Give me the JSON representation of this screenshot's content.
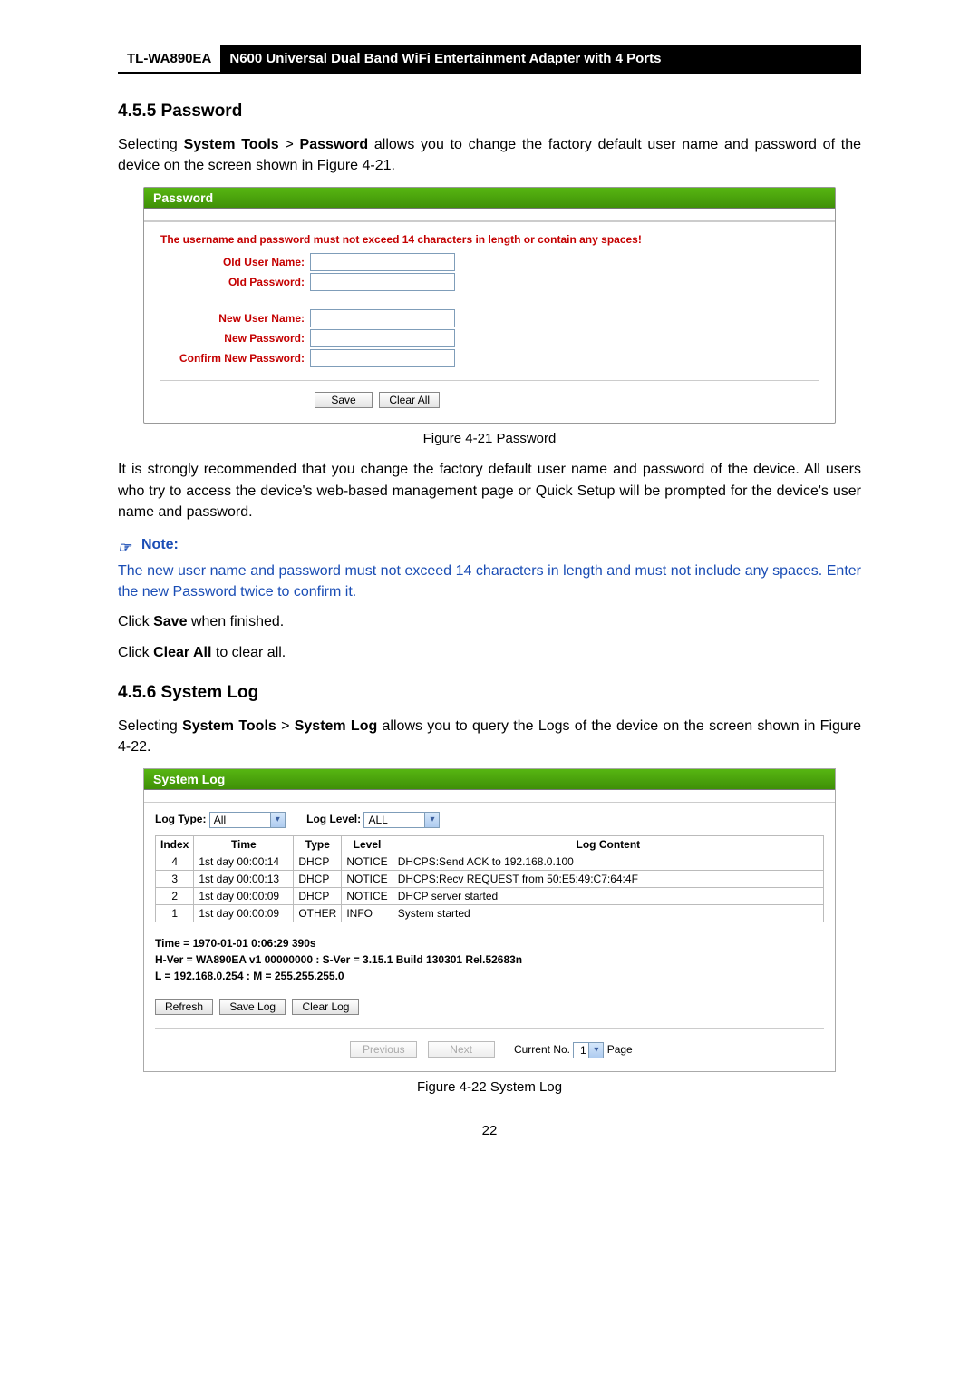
{
  "header": {
    "model": "TL-WA890EA",
    "desc": "N600 Universal Dual Band WiFi Entertainment Adapter with 4 Ports"
  },
  "sec455": {
    "heading": "4.5.5  Password",
    "intro_a": "Selecting ",
    "intro_b": "System Tools",
    "intro_c": " > ",
    "intro_d": "Password",
    "intro_e": " allows you to change the factory default user name and password of the device on the screen shown in Figure 4-21.",
    "panel_title": "Password",
    "warn": "The username and password must not exceed 14 characters in length or contain any spaces!",
    "labels": {
      "old_user": "Old User Name:",
      "old_pass": "Old Password:",
      "new_user": "New User Name:",
      "new_pass": "New Password:",
      "confirm": "Confirm New Password:"
    },
    "btn_save": "Save",
    "btn_clear": "Clear All",
    "fig": "Figure 4-21 Password",
    "para2": "It is strongly recommended that you change the factory default user name and password of the device. All users who try to access the device's web-based management page or Quick Setup will be prompted for the device's user name and password.",
    "note_heading": "Note:",
    "note_body": "The new user name and password must not exceed 14 characters in length and must not include any spaces. Enter the new Password twice to confirm it.",
    "click_save_a": "Click ",
    "click_save_b": "Save",
    "click_save_c": " when finished.",
    "click_clear_a": "Click ",
    "click_clear_b": "Clear All",
    "click_clear_c": " to clear all."
  },
  "sec456": {
    "heading": "4.5.6  System Log",
    "intro_a": "Selecting ",
    "intro_b": "System Tools",
    "intro_c": " > ",
    "intro_d": "System Log",
    "intro_e": " allows you to query the Logs of the device on the screen shown in Figure 4-22.",
    "panel_title": "System Log",
    "filters": {
      "type_label": "Log Type:",
      "type_value": "All",
      "level_label": "Log Level:",
      "level_value": "ALL"
    },
    "table": {
      "headers": [
        "Index",
        "Time",
        "Type",
        "Level",
        "Log Content"
      ],
      "rows": [
        {
          "index": "4",
          "time": "1st day 00:00:14",
          "type": "DHCP",
          "level": "NOTICE",
          "content": "DHCPS:Send ACK to 192.168.0.100"
        },
        {
          "index": "3",
          "time": "1st day 00:00:13",
          "type": "DHCP",
          "level": "NOTICE",
          "content": "DHCPS:Recv REQUEST from 50:E5:49:C7:64:4F"
        },
        {
          "index": "2",
          "time": "1st day 00:00:09",
          "type": "DHCP",
          "level": "NOTICE",
          "content": "DHCP server started"
        },
        {
          "index": "1",
          "time": "1st day 00:00:09",
          "type": "OTHER",
          "level": "INFO",
          "content": "System started"
        }
      ]
    },
    "meta": {
      "time": "Time = 1970-01-01 0:06:29 390s",
      "ver": "H-Ver = WA890EA v1 00000000 : S-Ver = 3.15.1 Build 130301 Rel.52683n",
      "net": "L = 192.168.0.254 : M = 255.255.255.0"
    },
    "btn_refresh": "Refresh",
    "btn_savelog": "Save Log",
    "btn_clearlog": "Clear Log",
    "pager": {
      "prev": "Previous",
      "next": "Next",
      "current_label": "Current No.",
      "current_value": "1",
      "page_label": "Page"
    },
    "fig": "Figure 4-22 System Log"
  },
  "page_number": "22"
}
